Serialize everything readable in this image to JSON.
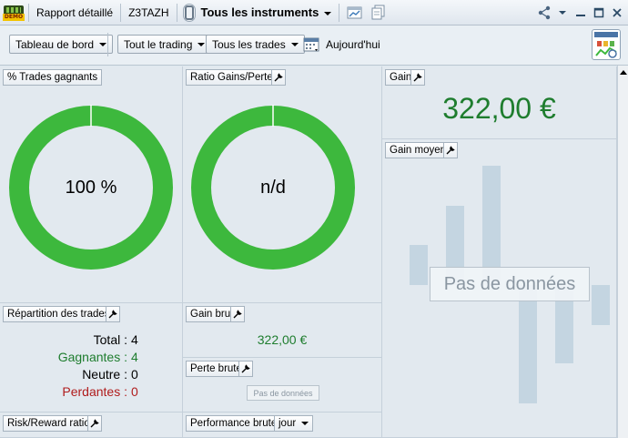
{
  "titlebar": {
    "demo_label": "DEMO",
    "report_label": "Rapport détaillé",
    "account_label": "Z3TAZH",
    "instruments_label": "Tous les instruments"
  },
  "toolbar": {
    "dashboard_label": "Tableau de bord",
    "trading_filter_label": "Tout le trading",
    "trades_filter_label": "Tous les trades",
    "date_label": "Aujourd'hui"
  },
  "panels": {
    "win_pct": {
      "title": "% Trades gagnants",
      "value_label": "100 %",
      "fraction": 1.0
    },
    "ratio": {
      "title": "Ratio Gains/Pertes",
      "value_label": "n/d",
      "fraction": 1.0
    },
    "gain": {
      "title": "Gain",
      "value": "322,00 €"
    },
    "gain_moyen": {
      "title": "Gain moyen",
      "no_data": "Pas de données"
    },
    "repartition": {
      "title": "Répartition des trades",
      "rows": [
        {
          "label": "Total :",
          "value": "4",
          "color": "#000000"
        },
        {
          "label": "Gagnantes :",
          "value": "4",
          "color": "#1e7d2e"
        },
        {
          "label": "Neutre :",
          "value": "0",
          "color": "#000000"
        },
        {
          "label": "Perdantes :",
          "value": "0",
          "color": "#b01c1c"
        }
      ]
    },
    "gain_brut": {
      "title": "Gain brut",
      "value": "322,00 €"
    },
    "perte_brute": {
      "title": "Perte brute",
      "no_data": "Pas de données"
    },
    "risk_reward": {
      "title": "Risk/Reward ratio"
    },
    "performance": {
      "title": "Performance brute",
      "period": "jour"
    }
  },
  "colors": {
    "donut_green": "#3db83d",
    "gain_green": "#1e7d2e",
    "loss_red": "#b01c1c"
  }
}
